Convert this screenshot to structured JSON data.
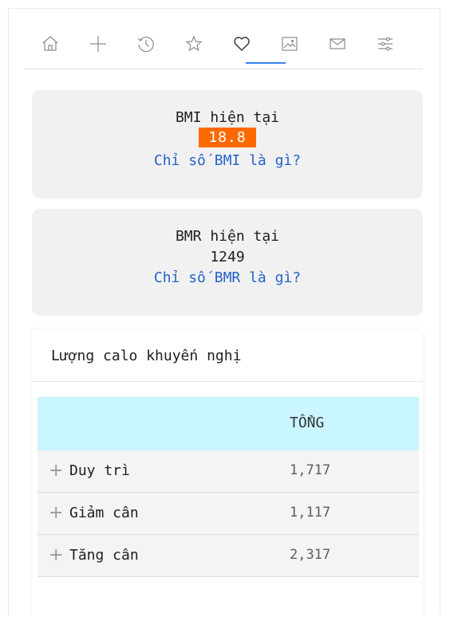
{
  "nav": {
    "items": [
      {
        "icon": "home-icon"
      },
      {
        "icon": "plus-icon"
      },
      {
        "icon": "history-icon"
      },
      {
        "icon": "star-icon"
      },
      {
        "icon": "heart-icon",
        "active": true
      },
      {
        "icon": "image-icon"
      },
      {
        "icon": "mail-icon"
      },
      {
        "icon": "sliders-icon"
      }
    ],
    "accent": "#3b82f6"
  },
  "bmi": {
    "label": "BMI hiện tại",
    "value": "18.8",
    "link": "Chỉ số BMI là gì?",
    "value_bg": "#ff6a00"
  },
  "bmr": {
    "label": "BMR hiện tại",
    "value": "1249",
    "link": "Chỉ số BMR là gì?"
  },
  "calories": {
    "title": "Lượng calo khuyến nghị",
    "column_total": "TỔNG",
    "header_bg": "#c9f6ff",
    "rows": [
      {
        "name": "Duy trì",
        "total": "1,717"
      },
      {
        "name": "Giảm cân",
        "total": "1,117"
      },
      {
        "name": "Tăng cân",
        "total": "2,317"
      }
    ]
  }
}
